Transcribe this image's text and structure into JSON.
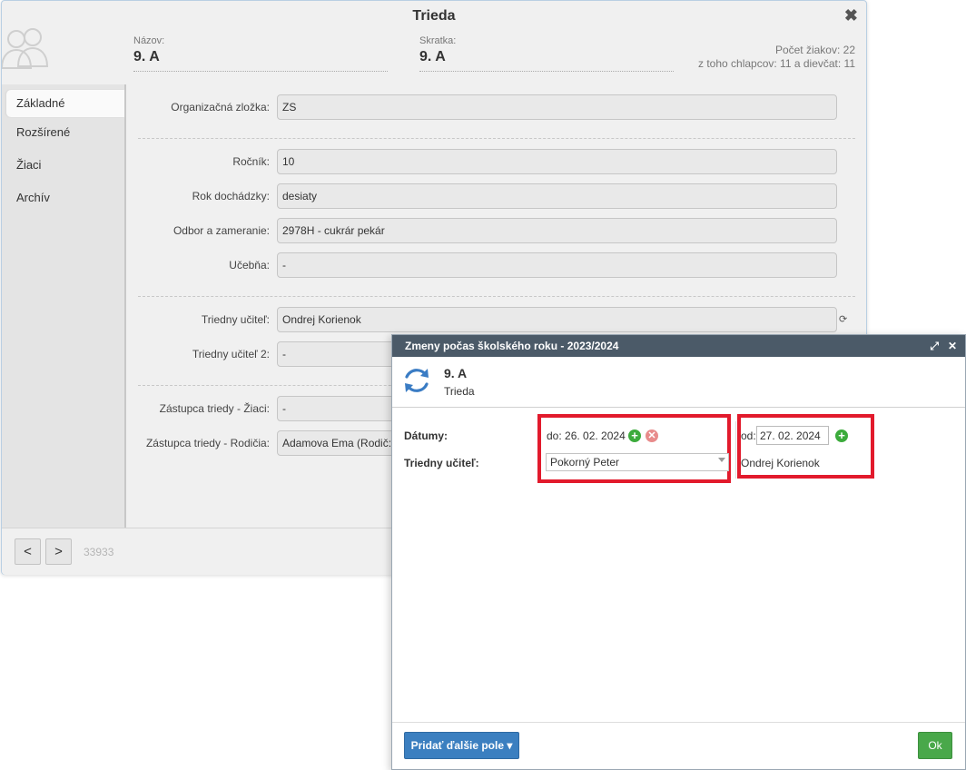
{
  "main_window": {
    "title": "Trieda",
    "header": {
      "name_label": "Názov:",
      "name_value": "9. A",
      "abbr_label": "Skratka:",
      "abbr_value": "9. A",
      "stats_line1": "Počet žiakov: 22",
      "stats_line2": "z toho chlapcov: 11 a dievčat: 11"
    },
    "sidebar": [
      {
        "label": "Základné",
        "active": true
      },
      {
        "label": "Rozšírené"
      },
      {
        "label": "Žiaci"
      },
      {
        "label": "Archív"
      }
    ],
    "fields": {
      "org_unit": {
        "label": "Organizačná zložka:",
        "value": "ZS"
      },
      "grade": {
        "label": "Ročník:",
        "value": "10"
      },
      "attendance_year": {
        "label": "Rok dochádzky:",
        "value": "desiaty"
      },
      "field_of_study": {
        "label": "Odbor a zameranie:",
        "value": "2978H - cukrár pekár"
      },
      "classroom": {
        "label": "Učebňa:",
        "value": "-"
      },
      "class_teacher": {
        "label": "Triedny učiteľ:",
        "value": "Ondrej Korienok"
      },
      "class_teacher_2": {
        "label": "Triedny učiteľ 2:",
        "value": "-"
      },
      "rep_students": {
        "label": "Zástupca triedy - Žiaci:",
        "value": "-"
      },
      "rep_parents": {
        "label": "Zástupca triedy - Rodičia:",
        "value": "Adamova Ema (Rodič:"
      }
    },
    "footer": {
      "prev_label": "<",
      "next_label": ">",
      "record_id": "33933"
    }
  },
  "dialog": {
    "title": "Zmeny počas školského roku - 2023/2024",
    "entity_name": "9. A",
    "entity_type": "Trieda",
    "dates_label": "Dátumy:",
    "teacher_label": "Triedny učiteľ:",
    "left_column": {
      "date_text": "do: 26. 02. 2024",
      "teacher_select": "Pokorný Peter"
    },
    "right_column": {
      "date_prefix": "od:",
      "date_value": "27. 02. 2024",
      "teacher": "Ondrej Korienok"
    },
    "add_field_button": "Pridať ďalšie pole ▾",
    "ok_button": "Ok"
  },
  "colors": {
    "highlight": "#e21a2c",
    "dialog_header": "#4b5a68",
    "primary_button": "#3b7fc0",
    "ok_button": "#49a84a"
  }
}
